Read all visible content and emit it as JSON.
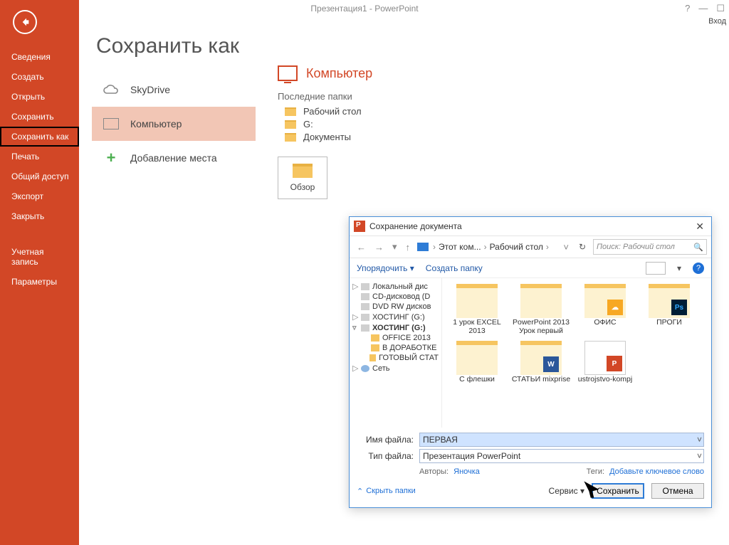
{
  "window": {
    "title": "Презентация1 - PowerPoint",
    "signin": "Вход"
  },
  "title_controls": {
    "help": "?",
    "minimize": "—",
    "close": "☐"
  },
  "sidebar": {
    "items": [
      "Сведения",
      "Создать",
      "Открыть",
      "Сохранить",
      "Сохранить как",
      "Печать",
      "Общий доступ",
      "Экспорт",
      "Закрыть",
      "Учетная запись",
      "Параметры"
    ],
    "active_index": 4
  },
  "page": {
    "title": "Сохранить как"
  },
  "locations": {
    "items": [
      {
        "label": "SkyDrive",
        "icon": "cloud"
      },
      {
        "label": "Компьютер",
        "icon": "pc"
      },
      {
        "label": "Добавление места",
        "icon": "plus"
      }
    ],
    "active_index": 1
  },
  "right": {
    "title": "Компьютер",
    "recent_label": "Последние папки",
    "recent": [
      "Рабочий стол",
      "G:",
      "Документы"
    ],
    "browse": "Обзор"
  },
  "dialog": {
    "title": "Сохранение документа",
    "nav": {
      "back": "←",
      "fwd": "→",
      "up": "↑",
      "crumbs": [
        "Этот ком...",
        "Рабочий стол"
      ],
      "search_placeholder": "Поиск: Рабочий стол"
    },
    "toolbar": {
      "organize": "Упорядочить",
      "newfolder": "Создать папку"
    },
    "tree": [
      {
        "label": "Локальный дис",
        "icon": "drv",
        "tri": "▷"
      },
      {
        "label": "CD-дисковод (D",
        "icon": "drv",
        "tri": ""
      },
      {
        "label": "DVD RW дисков",
        "icon": "drv",
        "tri": ""
      },
      {
        "label": "ХОСТИНГ (G:)",
        "icon": "drv",
        "tri": "▷"
      },
      {
        "label": "ХОСТИНГ (G:)",
        "icon": "drv",
        "tri": "▿",
        "bold": true
      },
      {
        "label": "OFFICE 2013",
        "icon": "fld",
        "tri": "",
        "indent": 1
      },
      {
        "label": "В ДОРАБОТКЕ",
        "icon": "fld",
        "tri": "",
        "indent": 1
      },
      {
        "label": "ГОТОВЫЙ СТАТ",
        "icon": "fld",
        "tri": "",
        "indent": 1
      },
      {
        "label": "Сеть",
        "icon": "net",
        "tri": "▷"
      }
    ],
    "files": [
      {
        "name": "1 урок EXCEL 2013",
        "kind": "folder"
      },
      {
        "name": "PowerPoint 2013 Урок первый",
        "kind": "folder"
      },
      {
        "name": "ОФИС",
        "kind": "folder",
        "overlay": "cloud"
      },
      {
        "name": "ПРОГИ",
        "kind": "folder",
        "overlay": "ps"
      },
      {
        "name": "С флешки",
        "kind": "folder"
      },
      {
        "name": "СТАТЬИ mixprise",
        "kind": "folder",
        "overlay": "w"
      },
      {
        "name": "ustrojstvo-kompj",
        "kind": "file",
        "overlay": "p"
      }
    ],
    "fields": {
      "filename_label": "Имя файла:",
      "filename_value": "ПЕРВАЯ",
      "filetype_label": "Тип файла:",
      "filetype_value": "Презентация PowerPoint",
      "authors_label": "Авторы:",
      "authors_value": "Яночка",
      "tags_label": "Теги:",
      "tags_value": "Добавьте ключевое слово"
    },
    "footer": {
      "hide": "Скрыть папки",
      "tools": "Сервис",
      "save": "Сохранить",
      "cancel": "Отмена"
    }
  }
}
